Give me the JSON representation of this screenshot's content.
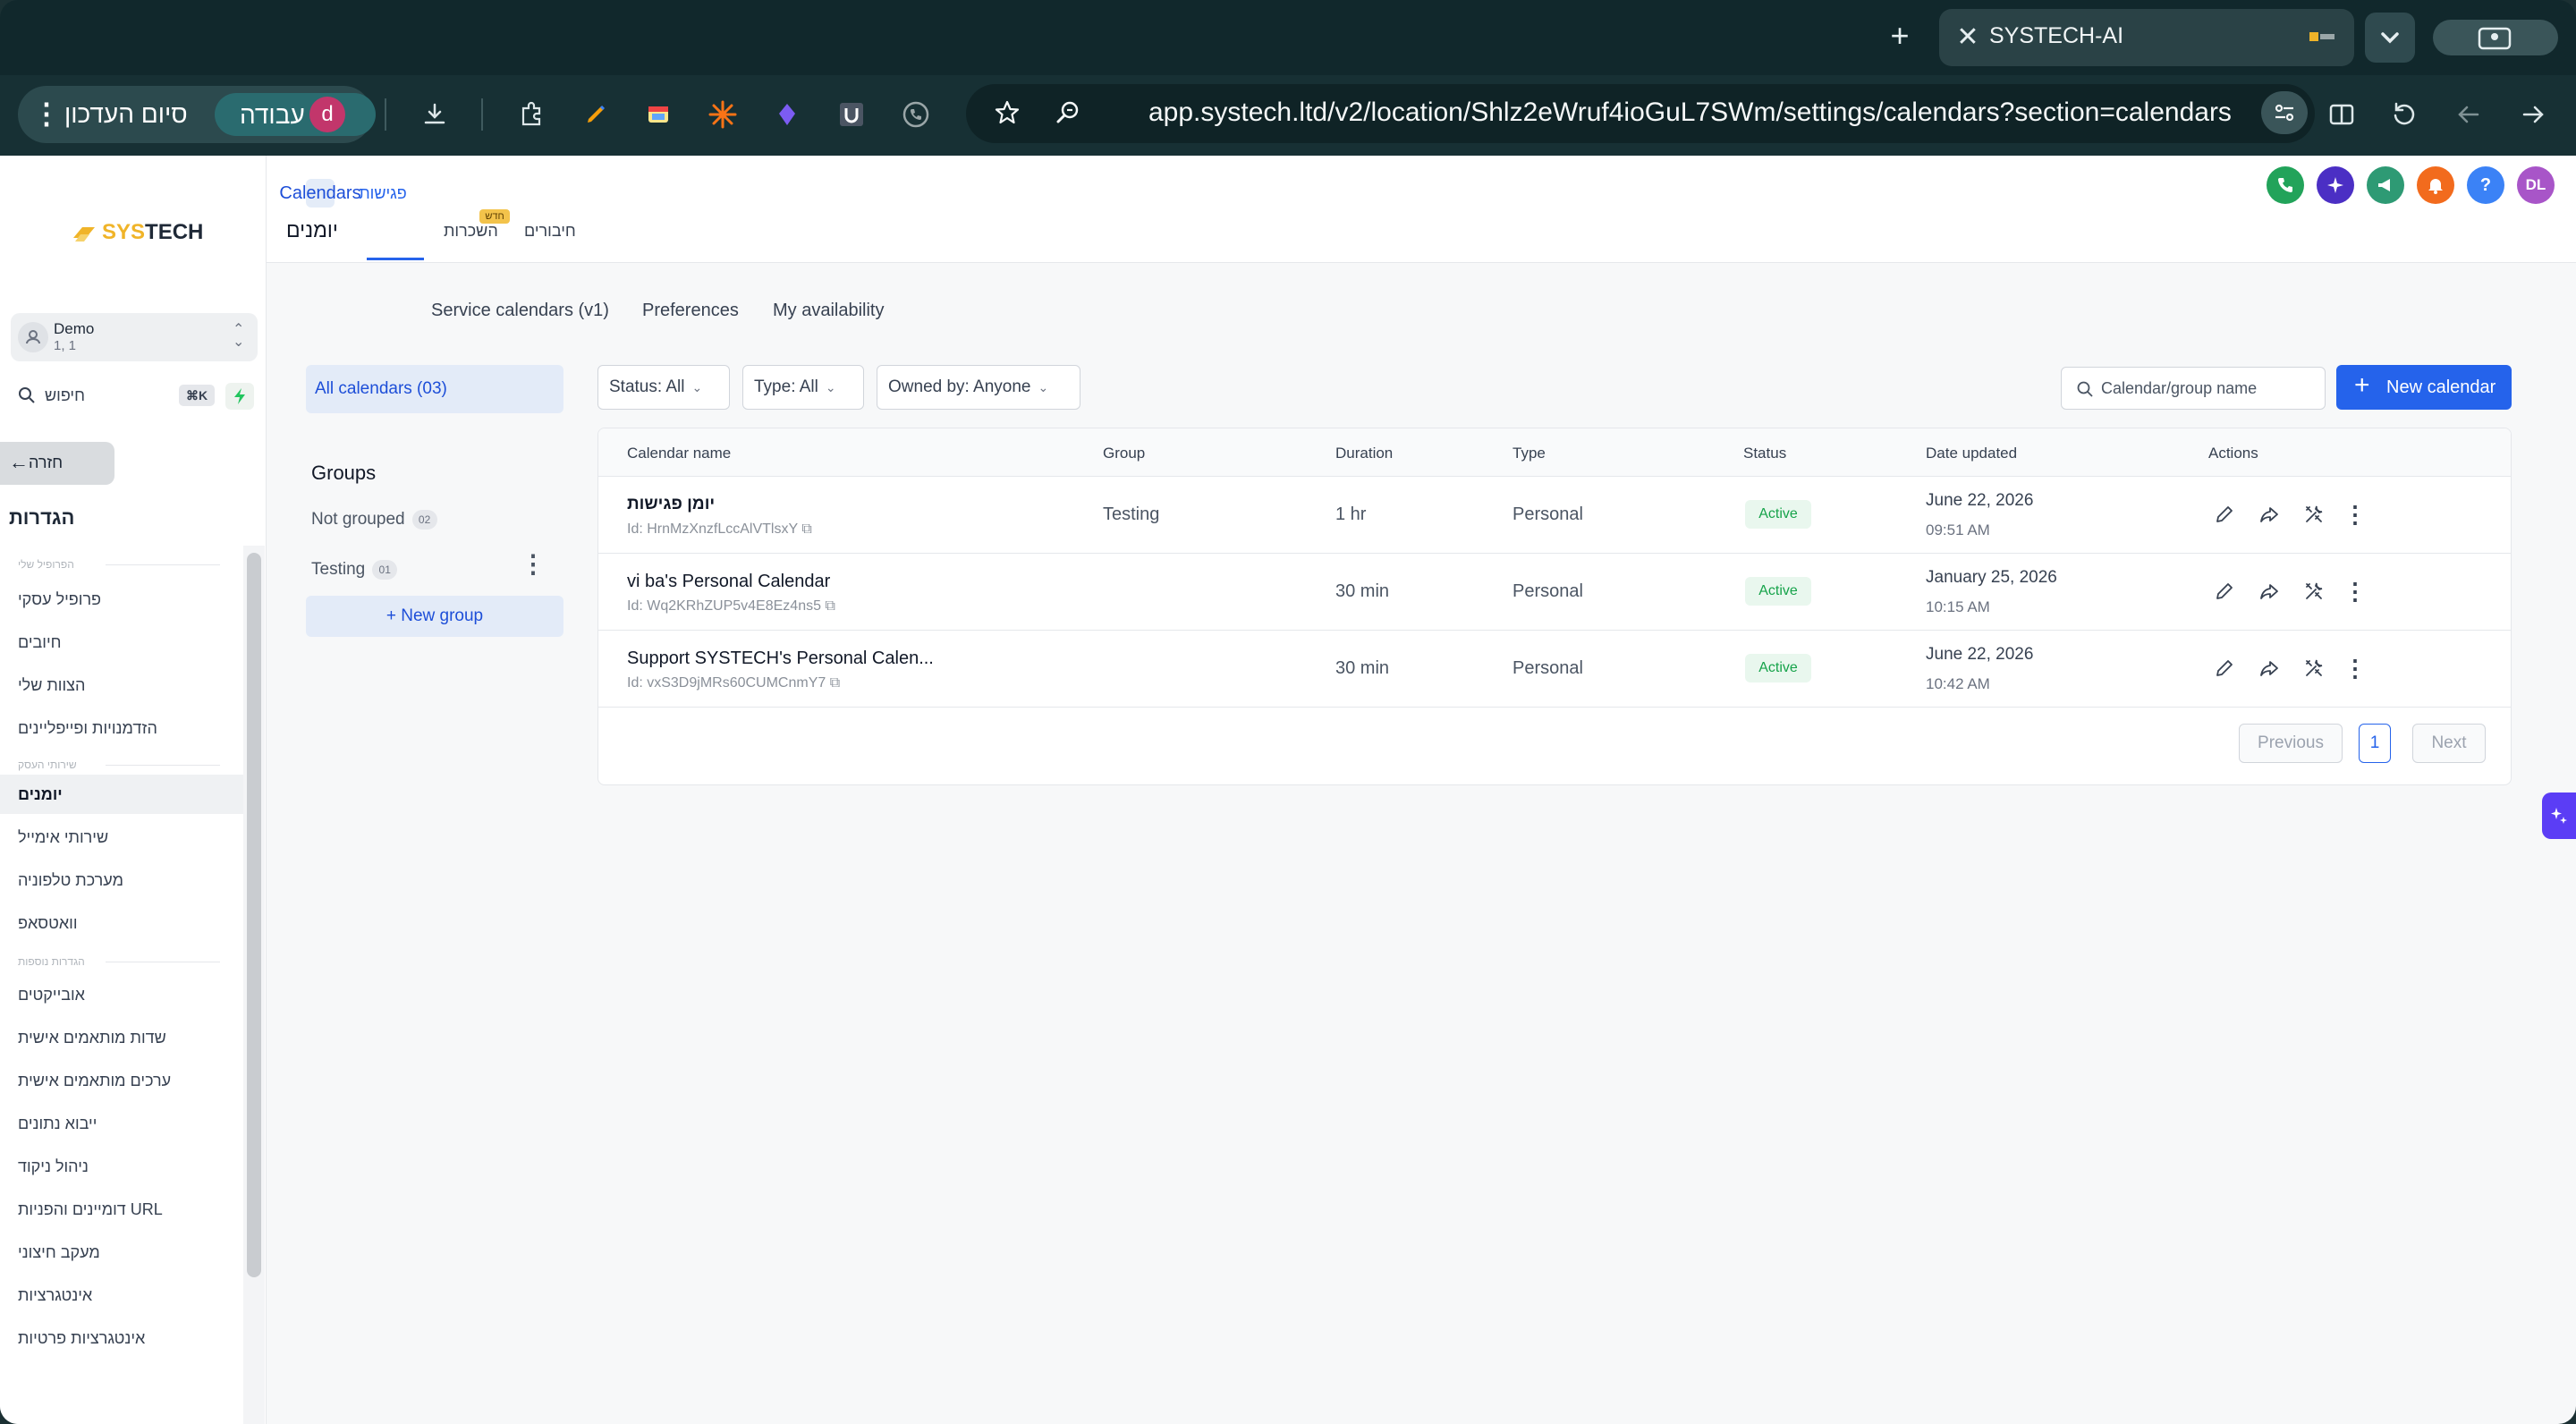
{
  "browser": {
    "tab_title": "SYSTECH-AI",
    "url": "app.systech.ltd/v2/location/Shlz2eWruf4ioGuL7SWm/settings/calendars?section=calendars",
    "update_pill_label": "סיום העדכון",
    "work_profile_label": "עבודה",
    "profile_initial": "d"
  },
  "app": {
    "logo_text_a": "SYS",
    "logo_text_b": "TECH",
    "account": {
      "name": "Demo",
      "sub": "1, 1"
    },
    "search": {
      "placeholder": "חיפוש",
      "shortcut": "⌘K"
    },
    "back_label": "חזרה",
    "settings_title": "הגדרות",
    "user_initials": "DL"
  },
  "sidebar": {
    "sections": [
      "הפרופיל שלי",
      "שירותי העסק",
      "הגדרות נוספות"
    ],
    "items": [
      "פרופיל עסקי",
      "חיובים",
      "הצוות שלי",
      "הזדמנויות ופייפליינים",
      "יומנים",
      "שירותי אימייל",
      "מערכת טלפוניה",
      "וואטסאפ",
      "אובייקטים",
      "שדות מותאמים אישית",
      "ערכים מותאמים אישית",
      "ייבוא נתונים",
      "ניהול ניקוד",
      "דומיינים והפניות URL",
      "מעקב חיצוני",
      "אינטגרציות",
      "אינטגרציות פרטיות"
    ],
    "active_item": "יומנים"
  },
  "header_tabs": {
    "calendars": "יומנים",
    "meetings": "פגישות",
    "rentals": "השכרות",
    "connections": "חיבורים",
    "new_badge": "חדש"
  },
  "subtabs": [
    "Calendars",
    "Service calendars (v1)",
    "Preferences",
    "My availability"
  ],
  "left_panel": {
    "all_calendars": "All calendars (03)",
    "groups_title": "Groups",
    "groups": [
      {
        "name": "Not grouped",
        "count": "02"
      },
      {
        "name": "Testing",
        "count": "01"
      }
    ],
    "new_group": "+ New group"
  },
  "filters": {
    "status": "Status: All",
    "type": "Type: All",
    "owned_by": "Owned by: Anyone",
    "search_placeholder": "Calendar/group name",
    "new_calendar": "New calendar"
  },
  "table": {
    "columns": [
      "Calendar name",
      "Group",
      "Duration",
      "Type",
      "Status",
      "Date updated",
      "Actions"
    ],
    "rows": [
      {
        "name": "יומן פגישות",
        "id": "Id: HrnMzXnzfLccAlVTlsxY",
        "group": "Testing",
        "duration": "1 hr",
        "type": "Personal",
        "status": "Active",
        "date": "June 22, 2026",
        "time": "09:51 AM"
      },
      {
        "name": "vi ba's Personal Calendar",
        "id": "Id: Wq2KRhZUP5v4E8Ez4ns5",
        "group": "",
        "duration": "30 min",
        "type": "Personal",
        "status": "Active",
        "date": "January 25, 2026",
        "time": "10:15 AM"
      },
      {
        "name": "Support SYSTECH's Personal Calen...",
        "id": "Id: vxS3D9jMRs60CUMCnmY7",
        "group": "",
        "duration": "30 min",
        "type": "Personal",
        "status": "Active",
        "date": "June 22, 2026",
        "time": "10:42 AM"
      }
    ],
    "pagination": {
      "previous": "Previous",
      "page": "1",
      "next": "Next"
    }
  }
}
